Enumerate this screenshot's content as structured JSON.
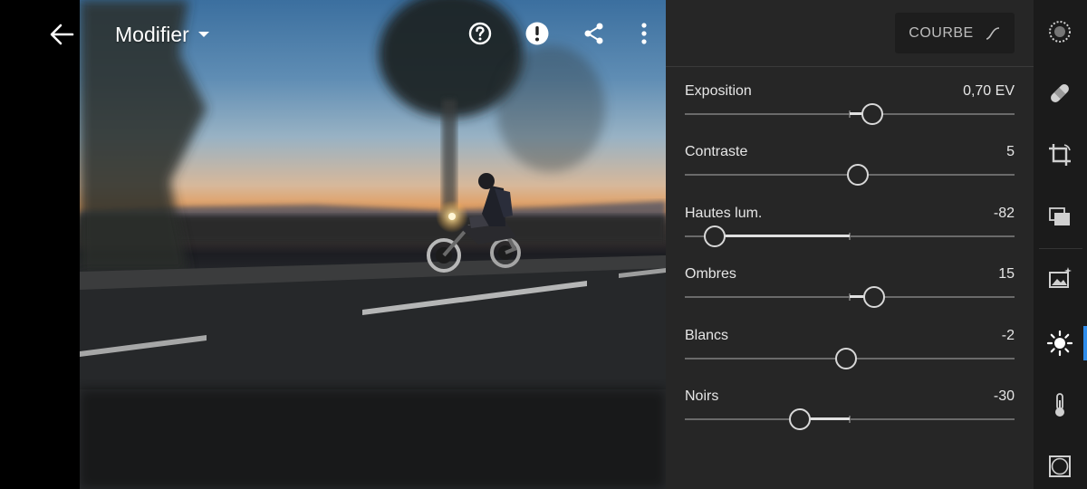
{
  "topbar": {
    "title": "Modifier",
    "icons": [
      "back-arrow-icon",
      "dropdown-caret-icon",
      "help-icon",
      "alert-icon",
      "share-icon",
      "more-vertical-icon"
    ]
  },
  "panel": {
    "curve_button": {
      "label": "COURBE",
      "icon": "curve-icon"
    },
    "sliders": [
      {
        "label": "Exposition",
        "value": "0,70 EV",
        "position": 0.57
      },
      {
        "label": "Contraste",
        "value": "5",
        "position": 0.525
      },
      {
        "label": "Hautes lum.",
        "value": "-82",
        "position": 0.09
      },
      {
        "label": "Ombres",
        "value": "15",
        "position": 0.575
      },
      {
        "label": "Blancs",
        "value": "-2",
        "position": 0.49
      },
      {
        "label": "Noirs",
        "value": "-30",
        "position": 0.35
      }
    ]
  },
  "rail": {
    "tools": [
      "selective-icon",
      "healing-icon",
      "crop-icon",
      "presets-icon",
      "auto-enhance-icon",
      "light-icon",
      "color-temperature-icon",
      "vignette-icon"
    ],
    "active_tool": "light-icon",
    "accent_color": "#2d8ceb"
  }
}
